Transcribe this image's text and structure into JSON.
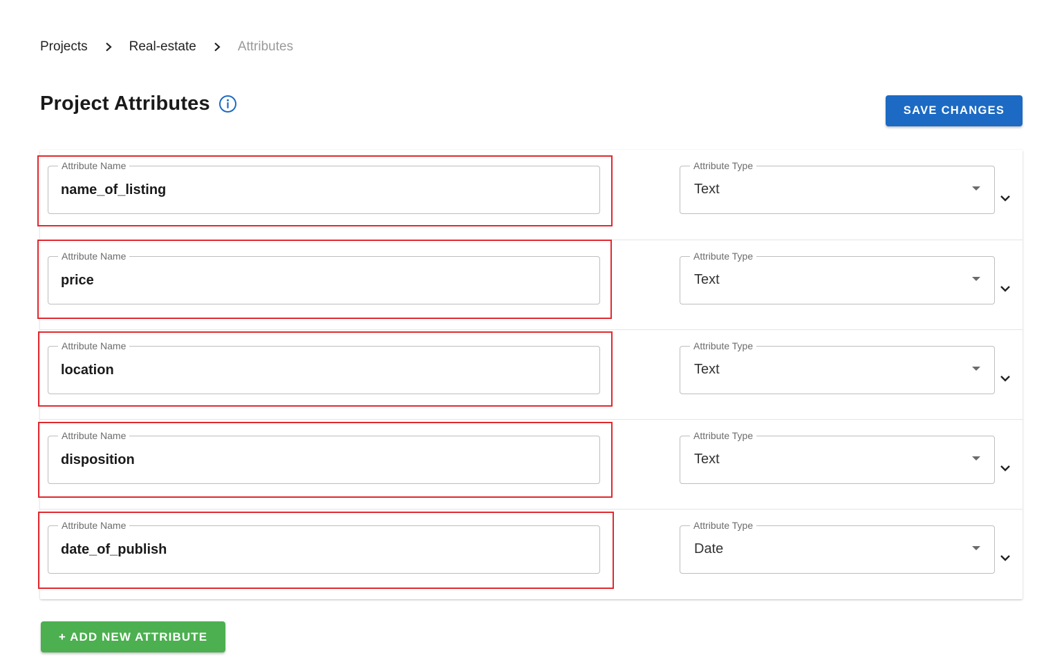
{
  "breadcrumb": {
    "items": [
      {
        "label": "Projects"
      },
      {
        "label": "Real-estate"
      },
      {
        "label": "Attributes"
      }
    ]
  },
  "header": {
    "title": "Project Attributes",
    "info_icon": "info-circle-icon",
    "save_label": "SAVE CHANGES"
  },
  "attributes": [
    {
      "name_label": "Attribute Name",
      "name_value": "name_of_listing",
      "type_label": "Attribute Type",
      "type_value": "Text"
    },
    {
      "name_label": "Attribute Name",
      "name_value": "price",
      "type_label": "Attribute Type",
      "type_value": "Text"
    },
    {
      "name_label": "Attribute Name",
      "name_value": "location",
      "type_label": "Attribute Type",
      "type_value": "Text"
    },
    {
      "name_label": "Attribute Name",
      "name_value": "disposition",
      "type_label": "Attribute Type",
      "type_value": "Text"
    },
    {
      "name_label": "Attribute Name",
      "name_value": "date_of_publish",
      "type_label": "Attribute Type",
      "type_value": "Date"
    }
  ],
  "footer": {
    "add_label": "+ ADD NEW ATTRIBUTE"
  },
  "colors": {
    "primary": "#1c6ac3",
    "success": "#4caf50",
    "highlight": "#e0282e"
  }
}
